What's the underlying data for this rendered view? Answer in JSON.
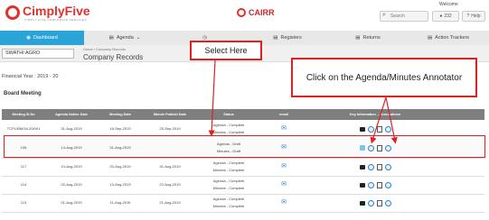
{
  "header": {
    "logo_text": "CimplyFive",
    "logo_tagline": "CIMPLY FIVE CORPORATE SERVICES",
    "product": "CAIRR",
    "welcome": "Welcome",
    "search_label": "Search",
    "user_label": "232",
    "help_label": "Help"
  },
  "nav": {
    "items": [
      {
        "label": "Dashboard"
      },
      {
        "label": "Agenda"
      },
      {
        "label": ""
      },
      {
        "label": "Registers"
      },
      {
        "label": "Returns"
      },
      {
        "label": "Action Trackers"
      }
    ]
  },
  "subheader": {
    "company": "SWATHI AGRO",
    "breadcrumb": "Home / Company Records",
    "title": "Company Records"
  },
  "financial_year": "Financial Year : 2019 - 20",
  "section_title": "Board Meeting",
  "table": {
    "columns": [
      "Meeting SI No",
      "Agenda Notice Date",
      "Meeting Date",
      "Minute Publish Date",
      "Status",
      "email",
      "Key Information ... Annotations"
    ],
    "rows": [
      {
        "sl": "TCPL/BM/18-20/001",
        "notice": "31-Aug-2019",
        "meeting": "18-Sep-2019",
        "publish": "25-Sep-2019",
        "status1": "Agenda - Complete",
        "status2": "Minutes - Complete"
      },
      {
        "sl": "106",
        "notice": "14-Aug-2019",
        "meeting": "31-Aug-2019",
        "publish": "",
        "status1": "Agenda - Draft",
        "status2": "Minutes - Draft"
      },
      {
        "sl": "117",
        "notice": "10-Aug-2019",
        "meeting": "20-Aug-2019",
        "publish": "31-Aug-2019",
        "status1": "Agenda - Complete",
        "status2": "Minutes - Complete"
      },
      {
        "sl": "114",
        "notice": "02-Aug-2019",
        "meeting": "13-Aug-2019",
        "publish": "22-Aug-2019",
        "status1": "Agenda - Complete",
        "status2": "Minutes - Complete"
      },
      {
        "sl": "113",
        "notice": "01-Aug-2019",
        "meeting": "11-Aug-2019",
        "publish": "21-Aug-2019",
        "status1": "Agenda - Complete",
        "status2": "Minutes - Complete"
      }
    ]
  },
  "callouts": {
    "select_here": "Select Here",
    "agenda_annotator": "Click on the Agenda/Minutes Annotator"
  },
  "colors": {
    "accent": "#2aa3d6",
    "brand_red": "#e0322b",
    "callout_red": "#e02020"
  }
}
